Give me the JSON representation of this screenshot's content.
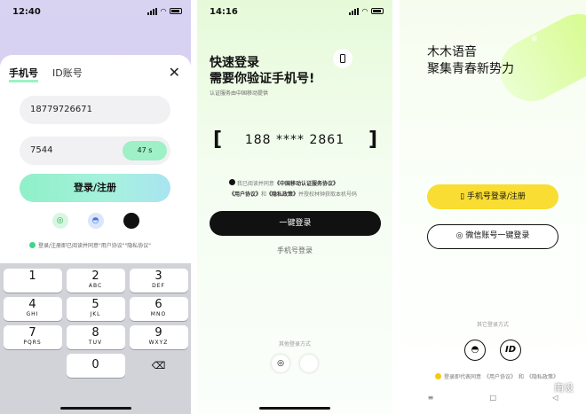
{
  "screen1": {
    "time": "12:40",
    "tab_phone": "手机号",
    "tab_id": "ID账号",
    "phone_value": "18779726671",
    "code_value": "7544",
    "timer": "47 s",
    "login_button": "登录/注册",
    "agreement": "登录/注册即已阅读并同意\"用户协议\"\"隐私协议\"",
    "keys": [
      {
        "n": "1",
        "l": ""
      },
      {
        "n": "2",
        "l": "ABC"
      },
      {
        "n": "3",
        "l": "DEF"
      },
      {
        "n": "4",
        "l": "GHI"
      },
      {
        "n": "5",
        "l": "JKL"
      },
      {
        "n": "6",
        "l": "MNO"
      },
      {
        "n": "7",
        "l": "PQRS"
      },
      {
        "n": "8",
        "l": "TUV"
      },
      {
        "n": "9",
        "l": "WXYZ"
      }
    ],
    "key_zero": "0"
  },
  "screen2": {
    "time": "14:16",
    "title_line1": "快速登录",
    "title_line2": "需要你验证手机号!",
    "subtitle": "认证服务由中国移动提供",
    "phone_masked": "188 **** 2861",
    "agree_prefix": "我已阅读并同意",
    "agree_cm": "《中国移动认证服务协议》",
    "agree_user": "《用户协议》",
    "agree_and": "和",
    "agree_privacy": "《隐私政策》",
    "agree_suffix": "并授权林钟获取本机号码",
    "one_key_login": "一键登录",
    "phone_login": "手机号登录",
    "other_methods": "其他登录方式"
  },
  "screen3": {
    "title_line1": "木木语音",
    "title_line2": "聚集青春新势力",
    "phone_button": "手机号登录/注册",
    "wechat_button": "微信账号一键登录",
    "other_methods": "其它登录方式",
    "id_label": "ID",
    "agree_prefix": "登录即代表同意",
    "agree_user": "《用户协议》",
    "agree_and": "和",
    "agree_privacy": "《隐私政策》",
    "watermark": "南设",
    "nav": [
      "≡",
      "□",
      "◁"
    ]
  },
  "colors": {
    "accent_green": "#9ef2c6",
    "accent_yellow": "#f9dd32",
    "dark_button": "#111111"
  }
}
